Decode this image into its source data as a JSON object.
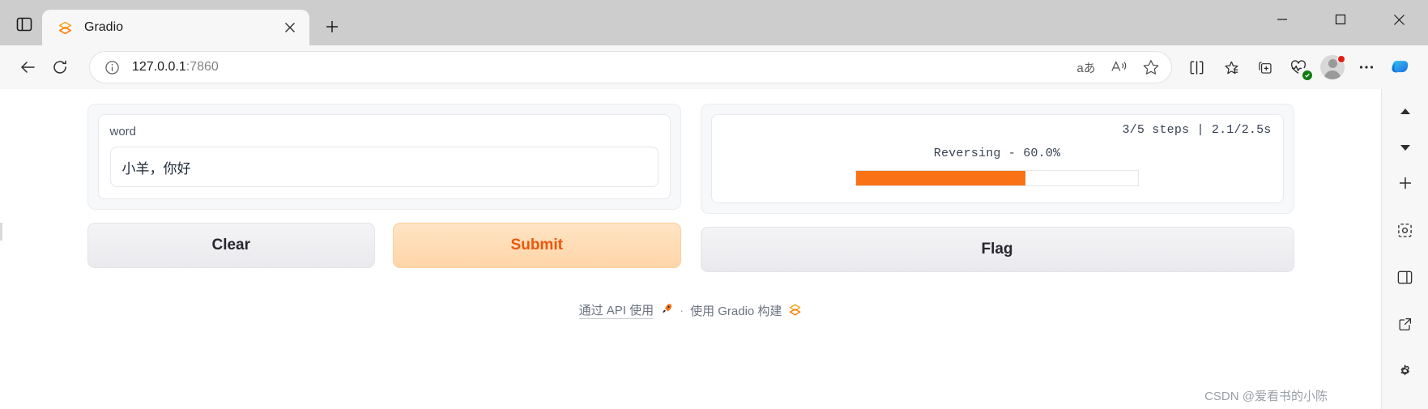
{
  "browser": {
    "tab": {
      "title": "Gradio",
      "favicon_icon": "gradio-logo-icon",
      "close_icon": "close-icon"
    },
    "tab_search_icon": "tab-search-icon",
    "new_tab_icon": "new-tab-plus-icon",
    "window_controls": {
      "minimize_icon": "minimize-icon",
      "maximize_icon": "maximize-icon",
      "close_icon": "window-close-icon"
    },
    "nav": {
      "back_icon": "back-arrow-icon",
      "refresh_icon": "refresh-icon",
      "info_icon": "site-info-icon",
      "url": "127.0.0.1",
      "url_port": ":7860",
      "omnibox_actions": [
        {
          "name": "translate-icon",
          "glyph": "aあ"
        },
        {
          "name": "read-aloud-icon",
          "glyph": "A"
        },
        {
          "name": "favorite-star-icon",
          "glyph": "☆"
        }
      ],
      "toolbar_icons": [
        {
          "name": "split-screen-icon"
        },
        {
          "name": "favorites-collection-icon"
        },
        {
          "name": "add-to-collections-icon"
        },
        {
          "name": "browser-essentials-icon"
        }
      ],
      "profile_name": "profile-avatar",
      "settings_more_icon": "settings-and-more-icon",
      "copilot_icon": "copilot-icon"
    },
    "sidebar_icons": [
      {
        "name": "scroll-up-icon"
      },
      {
        "name": "scroll-down-icon"
      },
      {
        "name": "add-icon"
      },
      {
        "name": "screenshot-capture-icon"
      },
      {
        "name": "sidebar-panel-icon"
      },
      {
        "name": "open-external-icon"
      },
      {
        "name": "settings-gear-icon"
      }
    ]
  },
  "app": {
    "input": {
      "label": "word",
      "value": "小羊，你好",
      "placeholder": ""
    },
    "buttons": {
      "clear": "Clear",
      "submit": "Submit",
      "flag": "Flag"
    },
    "progress": {
      "meta": "3/5 steps | 2.1/2.5s",
      "label": "Reversing - 60.0%",
      "percent": 60,
      "fill_color": "#f97316"
    },
    "footer": {
      "api_text": "通过 API 使用",
      "api_icon": "rocket-icon",
      "separator": "·",
      "built_with": "使用 Gradio 构建",
      "gradio_icon": "gradio-logo-icon"
    }
  },
  "watermark": "CSDN @爱看书的小陈"
}
